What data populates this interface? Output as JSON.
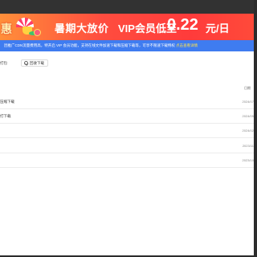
{
  "banner": {
    "badge_char": "惠",
    "title": "暑期大放价",
    "vip_text": "VIP会员低至",
    "price": "0.22",
    "unit": "元/日"
  },
  "notice": {
    "text": "因推广CDN流量费用高，特开启 VIP 会员功能，支持在线文件加速下载和压缩下载等，可享不限速下载特权 ",
    "link": "点击查看详情"
  },
  "toolbar": {
    "left_text": "打包",
    "recycle_label": "回收下载"
  },
  "table": {
    "date_header": "日期"
  },
  "rows": [
    {
      "name": "压缩下载",
      "date": "2024/07"
    },
    {
      "name": "打下载",
      "date": "2024/05"
    },
    {
      "name": "",
      "date": "2024/02"
    },
    {
      "name": "",
      "date": "2023/11"
    },
    {
      "name": "",
      "date": "2023/10"
    }
  ],
  "colors": {
    "banner_start": "#ff8f3a",
    "banner_end": "#ff3b3b",
    "notice_bg": "#3f7cf0",
    "notice_link": "#ffe14d"
  }
}
